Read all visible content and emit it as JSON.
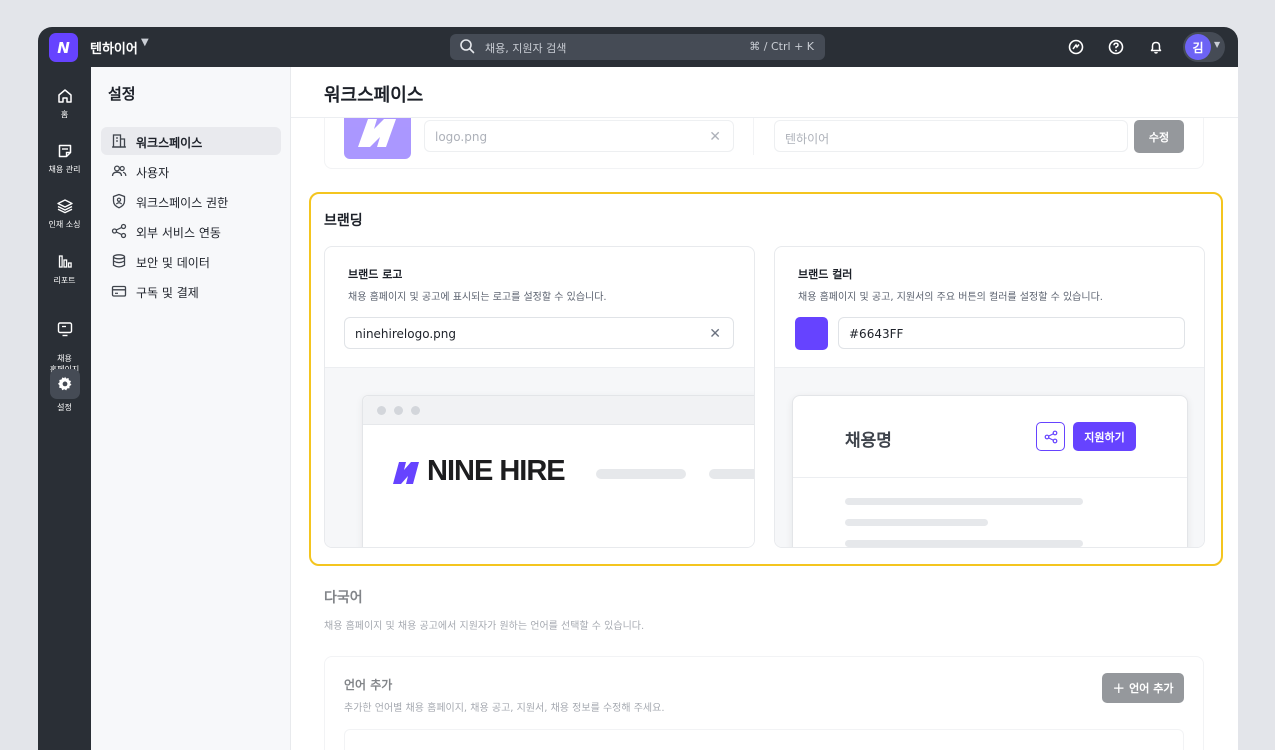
{
  "topbar": {
    "logo_letter": "N",
    "workspace_name": "텐하이어",
    "search_placeholder": "채용, 지원자 검색",
    "search_shortcut": "⌘ / Ctrl + K",
    "icons": [
      "chat-icon",
      "help-icon",
      "bell-icon"
    ],
    "avatar_initial": "김"
  },
  "rail": {
    "items": [
      {
        "label": "홈",
        "icon": "home-icon"
      },
      {
        "label": "채용 관리",
        "icon": "note-icon"
      },
      {
        "label": "인재 소싱",
        "icon": "layers-icon"
      },
      {
        "label": "리포트",
        "icon": "bar-chart-icon"
      },
      {
        "label": "채용\n홈페이지",
        "icon": "monitor-icon"
      },
      {
        "label": "설정",
        "icon": "gear-icon",
        "active": true
      }
    ]
  },
  "sidebar": {
    "title": "설정",
    "items": [
      {
        "label": "워크스페이스",
        "icon": "building-icon",
        "active": true
      },
      {
        "label": "사용자",
        "icon": "users-icon"
      },
      {
        "label": "워크스페이스 권한",
        "icon": "shield-user-icon"
      },
      {
        "label": "외부 서비스 연동",
        "icon": "share-icon"
      },
      {
        "label": "보안 및 데이터",
        "icon": "database-icon"
      },
      {
        "label": "구독 및 결제",
        "icon": "credit-card-icon"
      }
    ]
  },
  "main": {
    "title": "워크스페이스",
    "top_card": {
      "logo_file": "logo.png",
      "workspace_name": "텐하이어",
      "edit_button": "수정"
    },
    "branding": {
      "title": "브랜딩",
      "logo_card": {
        "title": "브랜드 로고",
        "desc": "채용 홈페이지 및 공고에 표시되는 로고를 설정할 수 있습니다.",
        "file": "ninehirelogo.png",
        "preview_logo_text": "NINE HIRE"
      },
      "color_card": {
        "title": "브랜드 컬러",
        "desc": "채용 홈페이지 및 공고, 지원서의 주요 버튼의 컬러를 설정할 수 있습니다.",
        "color_hex": "#6643FF",
        "preview_job_title": "채용명",
        "preview_apply_button": "지원하기"
      }
    },
    "language": {
      "title": "다국어",
      "desc": "채용 홈페이지 및 채용 공고에서 지원자가 원하는 언어를 선택할 수 있습니다.",
      "add_card_title": "언어 추가",
      "add_card_desc": "추가한 언어별 채용 홈페이지, 채용 공고, 지원서, 채용 정보를 수정해 주세요.",
      "add_button": "언어 추가"
    }
  },
  "colors": {
    "brand": "#6643FF",
    "nav_bg": "#2a2f36",
    "highlight": "#f4c51f"
  }
}
